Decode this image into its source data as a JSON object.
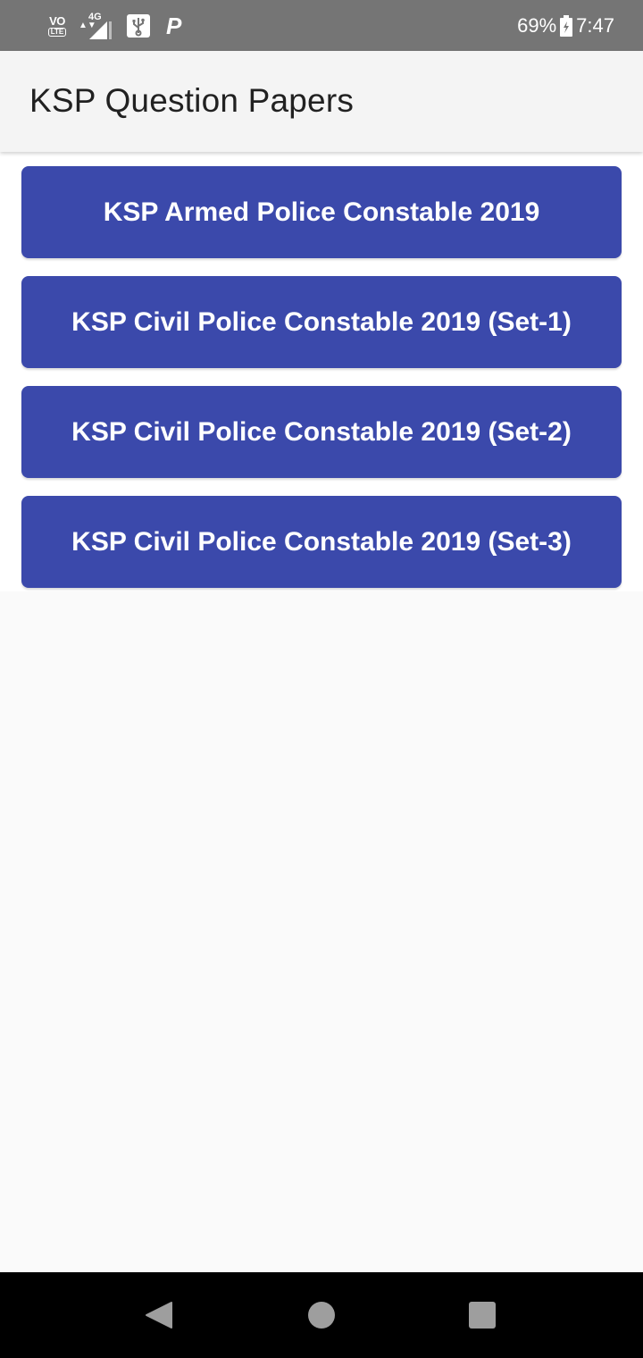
{
  "status_bar": {
    "volte_top": "VO",
    "volte_bottom": "LTE",
    "network_type": "4G",
    "network_arrows": "▲▼",
    "parking_letter": "P",
    "battery_percent": "69%",
    "time": "7:47",
    "icons": [
      "volte-icon",
      "signal-icon",
      "usb-icon",
      "parking-icon",
      "battery-icon"
    ]
  },
  "app_bar": {
    "title": "KSP Question Papers"
  },
  "papers": [
    {
      "label": "KSP Armed Police Constable 2019"
    },
    {
      "label": "KSP Civil Police Constable 2019 (Set-1)"
    },
    {
      "label": "KSP Civil Police Constable 2019 (Set-2)"
    },
    {
      "label": "KSP Civil Police Constable 2019 (Set-3)"
    }
  ],
  "nav_bar": {
    "icons": [
      "back-icon",
      "home-icon",
      "recent-apps-icon"
    ]
  },
  "colors": {
    "status_bar_bg": "#757575",
    "app_bar_bg": "#f4f4f4",
    "button_bg": "#3b49ab",
    "button_text": "#ffffff",
    "page_bg": "#fafafa",
    "nav_bar_bg": "#000000"
  }
}
